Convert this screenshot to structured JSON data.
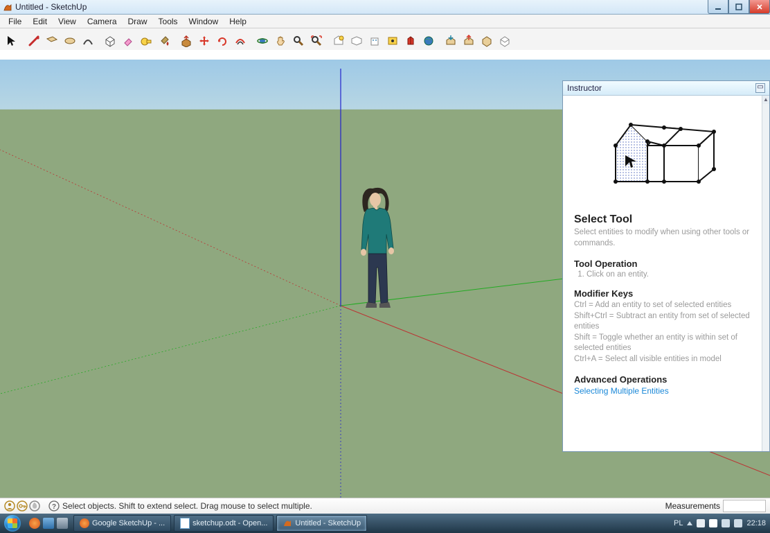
{
  "window": {
    "title": "Untitled - SketchUp"
  },
  "menu": {
    "file": "File",
    "edit": "Edit",
    "view": "View",
    "camera": "Camera",
    "draw": "Draw",
    "tools": "Tools",
    "window": "Window",
    "help": "Help"
  },
  "instructor": {
    "panel_title": "Instructor",
    "tool_title": "Select Tool",
    "tool_desc": "Select entities to modify when using other tools or commands.",
    "op_header": "Tool Operation",
    "op_step1": "Click on an entity.",
    "mk_header": "Modifier Keys",
    "mk_ctrl": "Ctrl = Add an entity to set of selected entities",
    "mk_shiftctrl": "Shift+Ctrl = Subtract an entity from set of selected entities",
    "mk_shift": "Shift = Toggle whether an entity is within set of selected entities",
    "mk_ctrla": "Ctrl+A = Select all visible entities in model",
    "adv_header": "Advanced Operations",
    "adv_link": "Selecting Multiple Entities"
  },
  "status": {
    "hint": "Select objects. Shift to extend select. Drag mouse to select multiple.",
    "measurements_label": "Measurements"
  },
  "taskbar": {
    "item1": "Google SketchUp - ...",
    "item2": "sketchup.odt - Open...",
    "item3": "Untitled - SketchUp",
    "lang": "PL",
    "clock": "22:18"
  }
}
